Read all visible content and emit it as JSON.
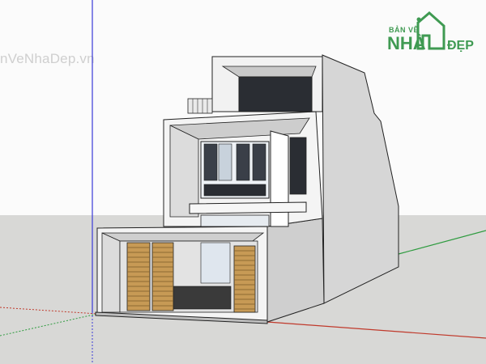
{
  "watermark": {
    "text": "nVeNhaDep.vn"
  },
  "logo": {
    "line1": "BẢN VẼ",
    "line2": "NHÀ",
    "line3": "ĐẸP",
    "color": "#3f9a52"
  },
  "colors": {
    "sky": "#fbfbfb",
    "ground": "#d8d8d6",
    "wall_light": "#f4f4f4",
    "wall_shade": "#d0d0d0",
    "glass": "#2a2d33",
    "wood": "#c79a55",
    "axis_red": "#c0392b",
    "axis_green": "#2e9b3f",
    "axis_blue": "#3a3ad8"
  }
}
